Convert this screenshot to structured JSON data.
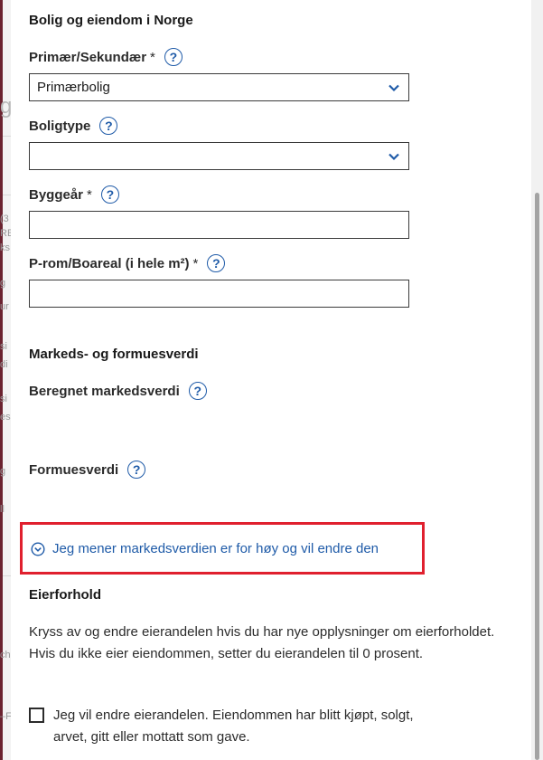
{
  "background_fragments": [
    "g",
    "(3",
    "RE",
    "ks",
    "g",
    "ur",
    "si",
    "di",
    "si",
    "es",
    "g",
    "ll",
    "ch",
    "–FO"
  ],
  "section_bolig": {
    "title": "Bolig og eiendom i Norge"
  },
  "fields": {
    "primar": {
      "label": "Primær/Sekundær",
      "required": "*",
      "value": "Primærbolig"
    },
    "boligtype": {
      "label": "Boligtype",
      "value": ""
    },
    "byggear": {
      "label": "Byggeår",
      "required": "*",
      "value": ""
    },
    "prom": {
      "label": "P-rom/Boareal (i hele m²)",
      "required": "*",
      "value": ""
    }
  },
  "section_marked": {
    "title": "Markeds- og formuesverdi",
    "beregnet_label": "Beregnet markedsverdi",
    "formue_label": "Formuesverdi",
    "expander_label": "Jeg mener markedsverdien er for høy og vil endre den"
  },
  "section_eierforhold": {
    "title": "Eierforhold",
    "paragraph": "Kryss av og endre eierandelen hvis du har nye opplysninger om eierforholdet. Hvis du ikke eier eiendommen, setter du eierandelen til 0 prosent.",
    "checkbox_label": "Jeg vil endre eierandelen. Eiendommen har blitt kjøpt, solgt, arvet, gitt eller mottatt som gave.",
    "checkbox_checked": false
  },
  "help_glyph": "?",
  "colors": {
    "link": "#1f5ba8",
    "highlight": "#e0202e",
    "accent": "#6b2330"
  }
}
